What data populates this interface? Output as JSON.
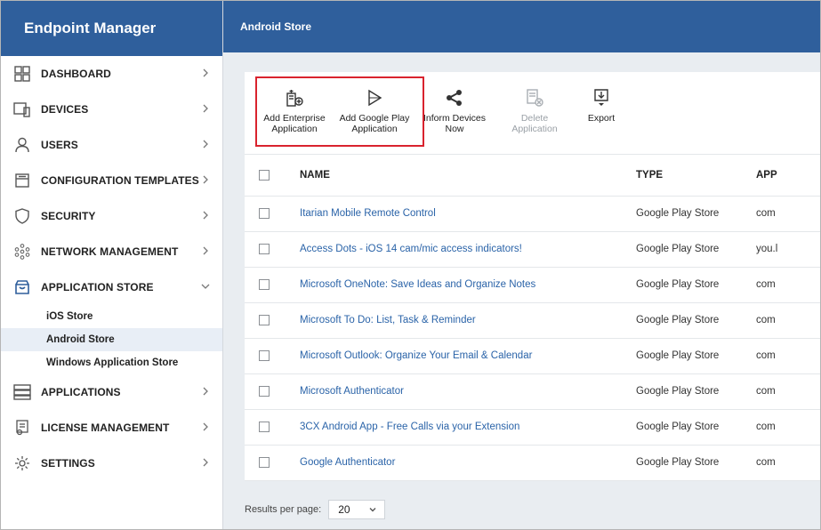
{
  "sidebar": {
    "brand": "Endpoint Manager",
    "items": [
      {
        "label": "DASHBOARD",
        "icon": "dashboard-icon"
      },
      {
        "label": "DEVICES",
        "icon": "devices-icon"
      },
      {
        "label": "USERS",
        "icon": "user-icon"
      },
      {
        "label": "CONFIGURATION TEMPLATES",
        "icon": "template-icon"
      },
      {
        "label": "SECURITY",
        "icon": "shield-icon"
      },
      {
        "label": "NETWORK MANAGEMENT",
        "icon": "network-icon"
      },
      {
        "label": "APPLICATION STORE",
        "icon": "store-icon"
      },
      {
        "label": "APPLICATIONS",
        "icon": "applications-icon"
      },
      {
        "label": "LICENSE MANAGEMENT",
        "icon": "license-icon"
      },
      {
        "label": "SETTINGS",
        "icon": "settings-icon"
      }
    ],
    "app_store_sub": [
      "iOS Store",
      "Android Store",
      "Windows Application Store"
    ]
  },
  "header": {
    "title": "Android Store"
  },
  "toolbar": {
    "add_enterprise": "Add Enterprise\nApplication",
    "add_google_play": "Add Google Play\nApplication",
    "inform_devices": "Inform Devices\nNow",
    "delete_app": "Delete\nApplication",
    "export": "Export"
  },
  "table": {
    "columns": [
      "NAME",
      "TYPE",
      "APP"
    ],
    "rows": [
      {
        "name": "Itarian Mobile Remote Control",
        "type": "Google Play Store",
        "app": "com"
      },
      {
        "name": "Access Dots - iOS 14 cam/mic access indicators!",
        "type": "Google Play Store",
        "app": "you.l"
      },
      {
        "name": "Microsoft OneNote: Save Ideas and Organize Notes",
        "type": "Google Play Store",
        "app": "com"
      },
      {
        "name": "Microsoft To Do: List, Task & Reminder",
        "type": "Google Play Store",
        "app": "com"
      },
      {
        "name": "Microsoft Outlook: Organize Your Email & Calendar",
        "type": "Google Play Store",
        "app": "com"
      },
      {
        "name": "Microsoft Authenticator",
        "type": "Google Play Store",
        "app": "com"
      },
      {
        "name": "3CX Android App - Free Calls via your Extension",
        "type": "Google Play Store",
        "app": "com"
      },
      {
        "name": "Google Authenticator",
        "type": "Google Play Store",
        "app": "com"
      }
    ]
  },
  "pager": {
    "label": "Results per page:",
    "value": "20"
  },
  "colors": {
    "brand": "#2f5f9c",
    "link": "#2a63a8",
    "highlight": "#d9232e"
  }
}
